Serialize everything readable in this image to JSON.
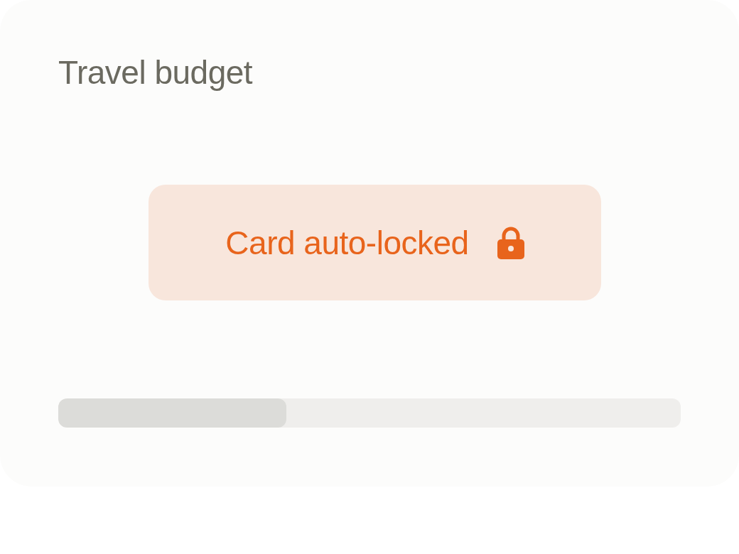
{
  "card": {
    "title": "Travel budget"
  },
  "status": {
    "text": "Card auto-locked",
    "locked": true
  },
  "progress": {
    "level": 0.366
  }
}
